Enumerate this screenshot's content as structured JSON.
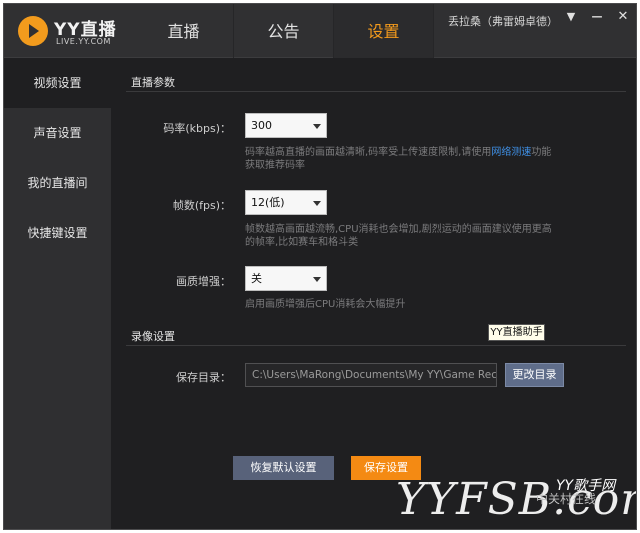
{
  "header": {
    "logo_text": "YY直播",
    "logo_sub": "LIVE.YY.COM",
    "tabs": [
      {
        "label": "直播"
      },
      {
        "label": "公告"
      },
      {
        "label": "设置"
      }
    ],
    "user_name": "丢拉桑（弗雷姆卓德）",
    "window_buttons": {
      "menu": "▼",
      "minimize": "—",
      "close": "✕"
    }
  },
  "sidebar": {
    "items": [
      {
        "label": "视频设置"
      },
      {
        "label": "声音设置"
      },
      {
        "label": "我的直播间"
      },
      {
        "label": "快捷键设置"
      }
    ]
  },
  "live_params": {
    "title": "直播参数",
    "bitrate": {
      "label": "码率(kbps)：",
      "value": "300",
      "hint_pre": "码率越高直播的画面越清晰,码率受上传速度限制,请使用",
      "hint_link": "网络测速",
      "hint_post": "功能获取推荐码率"
    },
    "fps": {
      "label": "帧数(fps)：",
      "value": "12(低)",
      "hint": "帧数越高画面越流畅,CPU消耗也会增加,剧烈运动的画面建议使用更高的帧率,比如赛车和格斗类"
    },
    "enhance": {
      "label": "画质增强：",
      "value": "关",
      "hint": "启用画质增强后CPU消耗会大幅提升"
    }
  },
  "record": {
    "title": "录像设置",
    "tooltip": "YY直播助手",
    "dir_label": "保存目录：",
    "dir_value": "C:\\Users\\MaRong\\Documents\\My YY\\Game Record",
    "change_button": "更改目录"
  },
  "actions": {
    "restore_default": "恢复默认设置",
    "save": "保存设置"
  },
  "watermark": {
    "text": "YYFSB.com",
    "line1": "YY歌手网",
    "line2": "中关村在线"
  }
}
